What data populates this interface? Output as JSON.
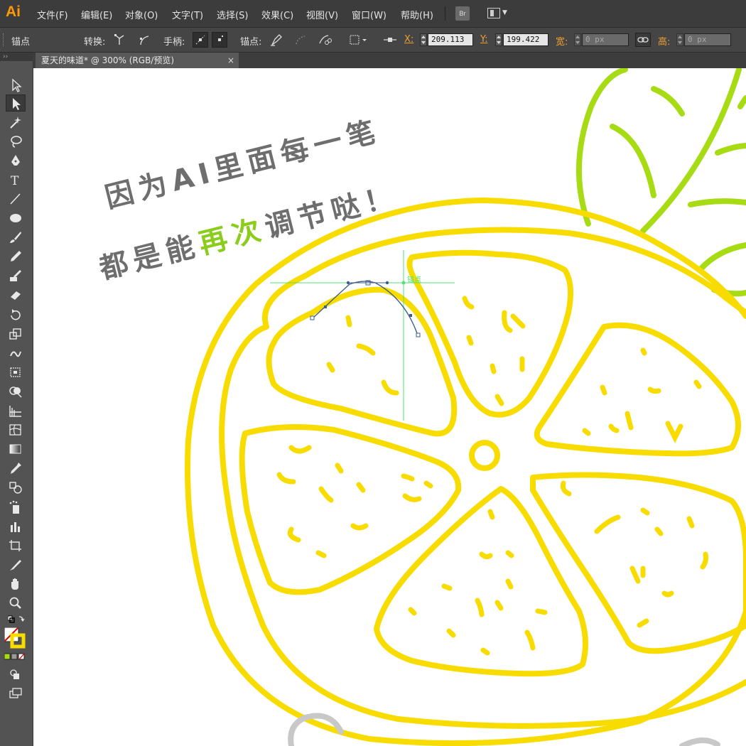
{
  "app": {
    "logo": "Ai"
  },
  "menu": [
    "文件(F)",
    "编辑(E)",
    "对象(O)",
    "文字(T)",
    "选择(S)",
    "效果(C)",
    "视图(V)",
    "窗口(W)",
    "帮助(H)"
  ],
  "bridge_label": "Br",
  "control_bar": {
    "mode_label": "锚点",
    "convert_label": "转换:",
    "handles_label": "手柄:",
    "anchors_label": "锚点:",
    "x_label": "X:",
    "x_value": "209.113",
    "y_label": "Y:",
    "y_value": "199.422",
    "width_label": "宽:",
    "width_value": "0 px",
    "height_label": "高:",
    "height_value": "0 px"
  },
  "document_tab": {
    "title": "夏天的味道* @ 300% (RGB/预览)",
    "close": "×"
  },
  "panel_grip": "››",
  "canvas": {
    "annotation_line1": "因为AI里面每一笔",
    "annotation_line2_pre": "都是能",
    "annotation_line2_highlight": "再次",
    "annotation_line2_post": "调节哒！",
    "anchor_hint": "锚点"
  },
  "colors": {
    "lemon": "#f8dc00",
    "leaf": "#a7dc14",
    "highlight": "#8ccc1c",
    "guide": "#55e07a",
    "path": "#3d5f8a"
  }
}
